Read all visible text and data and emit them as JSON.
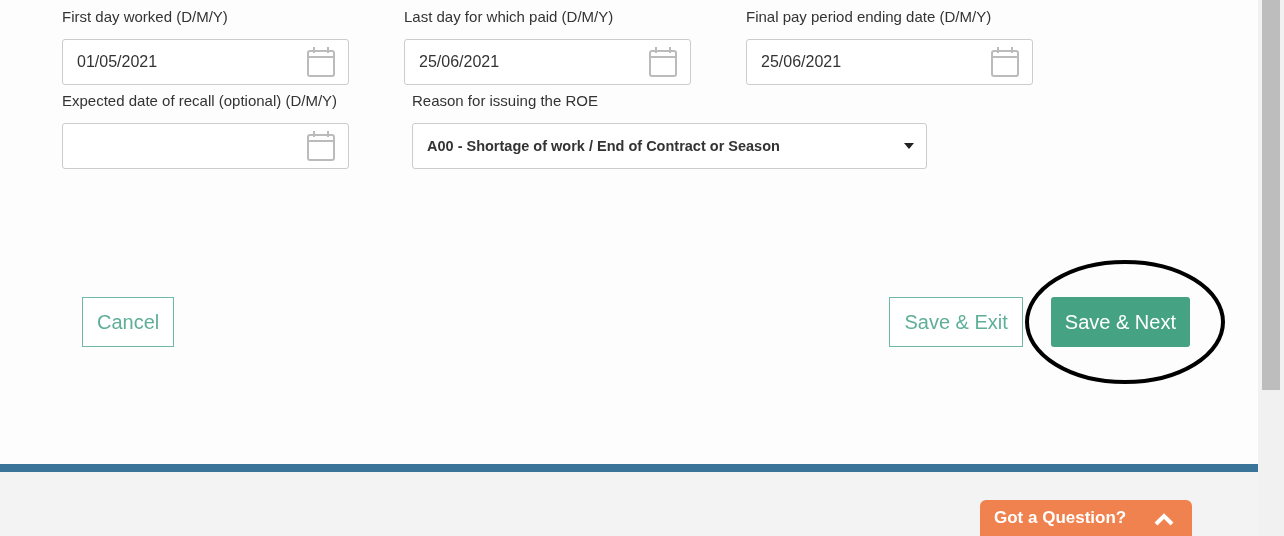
{
  "form": {
    "rows": [
      [
        {
          "kind": "date",
          "label": "First day worked (D/M/Y)",
          "value": "01/05/2021"
        },
        {
          "kind": "date",
          "label": "Last day for which paid (D/M/Y)",
          "value": "25/06/2021"
        },
        {
          "kind": "date",
          "label": "Final pay period ending date (D/M/Y)",
          "value": "25/06/2021"
        }
      ],
      [
        {
          "kind": "date",
          "label": "Expected date of recall (optional) (D/M/Y)"
        },
        {
          "kind": "select",
          "label": "Reason for issuing the ROE",
          "value": "A00 - Shortage of work / End of Contract or Season"
        }
      ]
    ]
  },
  "buttons": [
    {
      "kind": "outline",
      "label": "Cancel"
    },
    {
      "kind": "outline",
      "label": "Save & Exit"
    },
    {
      "kind": "primary",
      "label": "Save & Next",
      "highlighted": true
    }
  ],
  "help_tab": {
    "label": "Got a Question?"
  }
}
